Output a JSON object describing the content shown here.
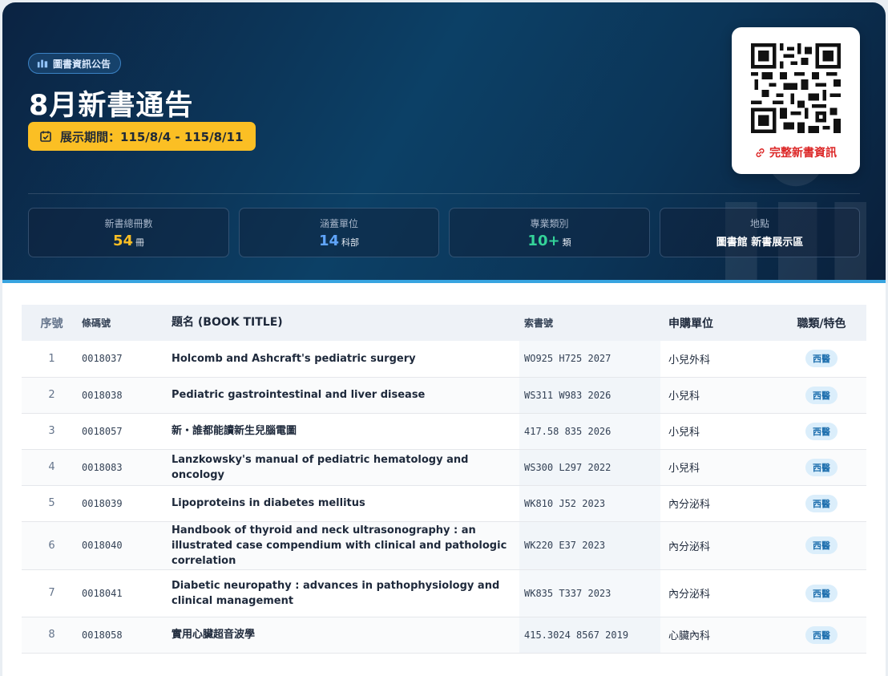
{
  "header": {
    "badge_label": "圖書資訊公告",
    "title": "8月新書通告",
    "period": "展示期間：115/8/4 - 115/8/11",
    "qr_link_label": "完整新書資訊"
  },
  "stats": [
    {
      "label": "新書總冊數",
      "value": "54",
      "unit": "冊",
      "color": "#fbbf24"
    },
    {
      "label": "涵蓋單位",
      "value": "14",
      "unit": "科部",
      "color": "#60a5fa"
    },
    {
      "label": "專業類別",
      "value": "10+",
      "unit": "類",
      "color": "#34d399"
    },
    {
      "label": "地點",
      "value": "圖書館 新書展示區",
      "unit": "",
      "color": "#ffffff"
    }
  ],
  "table": {
    "headers": {
      "no": "序號",
      "barcode": "條碼號",
      "title": "題名 (BOOK TITLE)",
      "call": "索書號",
      "dept": "申購單位",
      "tag": "職類/特色"
    },
    "rows": [
      {
        "no": "1",
        "barcode": "0018037",
        "title": "Holcomb and Ashcraft's pediatric surgery",
        "call": "WO925 H725 2027",
        "dept": "小兒外科",
        "tag": "西醫"
      },
      {
        "no": "2",
        "barcode": "0018038",
        "title": "Pediatric gastrointestinal and liver disease",
        "call": "WS311 W983 2026",
        "dept": "小兒科",
        "tag": "西醫"
      },
      {
        "no": "3",
        "barcode": "0018057",
        "title": "新・誰都能讀新生兒腦電圖",
        "call": "417.58 835 2026",
        "dept": "小兒科",
        "tag": "西醫"
      },
      {
        "no": "4",
        "barcode": "0018083",
        "title": "Lanzkowsky's manual of pediatric hematology and oncology",
        "call": "WS300 L297 2022",
        "dept": "小兒科",
        "tag": "西醫"
      },
      {
        "no": "5",
        "barcode": "0018039",
        "title": "Lipoproteins in diabetes mellitus",
        "call": "WK810 J52 2023",
        "dept": "內分泌科",
        "tag": "西醫"
      },
      {
        "no": "6",
        "barcode": "0018040",
        "title": "Handbook of thyroid and neck ultrasonography : an illustrated case compendium with clinical and pathologic correlation",
        "call": "WK220 E37 2023",
        "dept": "內分泌科",
        "tag": "西醫"
      },
      {
        "no": "7",
        "barcode": "0018041",
        "title": "Diabetic neuropathy : advances in pathophysiology and clinical management",
        "call": "WK835 T337 2023",
        "dept": "內分泌科",
        "tag": "西醫"
      },
      {
        "no": "8",
        "barcode": "0018058",
        "title": "實用心臟超音波學",
        "call": "415.3024 8567 2019",
        "dept": "心臟內科",
        "tag": "西醫"
      }
    ]
  }
}
